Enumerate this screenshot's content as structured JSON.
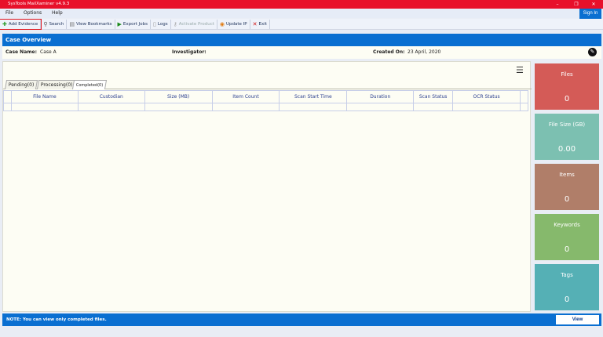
{
  "window": {
    "title": "SysTools MailXaminer v4.9.3",
    "sign_in": "Sign In"
  },
  "menu": [
    "File",
    "Options",
    "Help"
  ],
  "toolbar": [
    {
      "label": "Add Evidence",
      "icon": "add-evidence-icon",
      "glyph": "✚",
      "color": "#2a9a2a"
    },
    {
      "label": "Search",
      "icon": "search-icon",
      "glyph": "⚲",
      "color": "#555"
    },
    {
      "label": "View Bookmarks",
      "icon": "bookmarks-icon",
      "glyph": "▤",
      "color": "#777"
    },
    {
      "label": "Export Jobs",
      "icon": "export-icon",
      "glyph": "▶",
      "color": "#1a8a1a"
    },
    {
      "label": "Logs",
      "icon": "logs-icon",
      "glyph": "▯",
      "color": "#999"
    },
    {
      "label": "Activate Product",
      "icon": "activate-icon",
      "glyph": "⚷",
      "color": "#aaa"
    },
    {
      "label": "Update IP",
      "icon": "update-ip-icon",
      "glyph": "◉",
      "color": "#e07a10"
    },
    {
      "label": "Exit",
      "icon": "exit-icon",
      "glyph": "✕",
      "color": "#d01010"
    }
  ],
  "case": {
    "header": "Case Overview",
    "name_label": "Case Name:",
    "name": "Case A",
    "investigator_label": "Investigator:",
    "investigator": "",
    "created_label": "Created On:",
    "created": "23 April, 2020"
  },
  "tabs": [
    "Pending(0)",
    "Processing(0)",
    "Completed(0)"
  ],
  "table": {
    "columns": [
      "File Name",
      "Custodian",
      "Size (MB)",
      "Item Count",
      "Scan Start Time",
      "Duration",
      "Scan Status",
      "OCR Status"
    ]
  },
  "stats": [
    {
      "label": "Files",
      "value": "0",
      "color": "#d45b57"
    },
    {
      "label": "File Size (GB)",
      "value": "0.00",
      "color": "#7cc0b1"
    },
    {
      "label": "Items",
      "value": "0",
      "color": "#b07e69"
    },
    {
      "label": "Keywords",
      "value": "0",
      "color": "#86b96c"
    },
    {
      "label": "Tags",
      "value": "0",
      "color": "#55b0b5"
    }
  ],
  "footer": {
    "note": "NOTE: You can view only completed files.",
    "view": "View"
  }
}
